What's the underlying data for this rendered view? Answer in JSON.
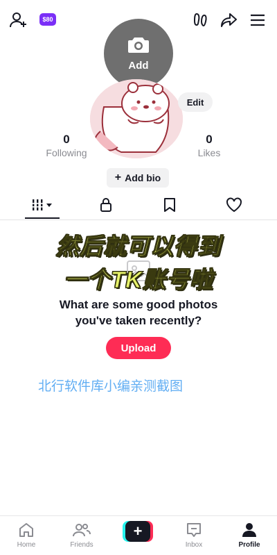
{
  "topbar": {
    "add_friend_icon": "person-plus-icon",
    "coins_badge": "$80",
    "footprints_icon": "footprints-icon",
    "share_icon": "share-arrow-icon",
    "menu_icon": "hamburger-menu-icon"
  },
  "avatar": {
    "add_label": "Add",
    "camera_icon": "camera-icon",
    "edit_label": "Edit"
  },
  "stats": {
    "following": {
      "value": "0",
      "label": "Following"
    },
    "likes": {
      "value": "0",
      "label": "Likes"
    }
  },
  "bio": {
    "plus": "+",
    "label": "Add bio"
  },
  "tabs": [
    {
      "icon": "grid-videos-icon",
      "active": true
    },
    {
      "icon": "lock-icon",
      "active": false
    },
    {
      "icon": "bookmark-icon",
      "active": false
    },
    {
      "icon": "heart-icon",
      "active": false
    }
  ],
  "overlay": {
    "line1": "然后就可以得到",
    "line2": "一个TK账号啦"
  },
  "empty_state": {
    "prompt_line1": "What are some good photos",
    "prompt_line2": "you've taken recently?",
    "upload_label": "Upload"
  },
  "caption": "北行软件库小编亲测截图",
  "bottom_nav": {
    "home": "Home",
    "friends": "Friends",
    "create": "+",
    "inbox": "Inbox",
    "profile": "Profile"
  },
  "colors": {
    "accent": "#fe2c55",
    "cyan": "#25f4ee",
    "badge": "#7b2ff7",
    "overlay_text": "#e7f36b",
    "caption_blue": "#62aef3"
  }
}
